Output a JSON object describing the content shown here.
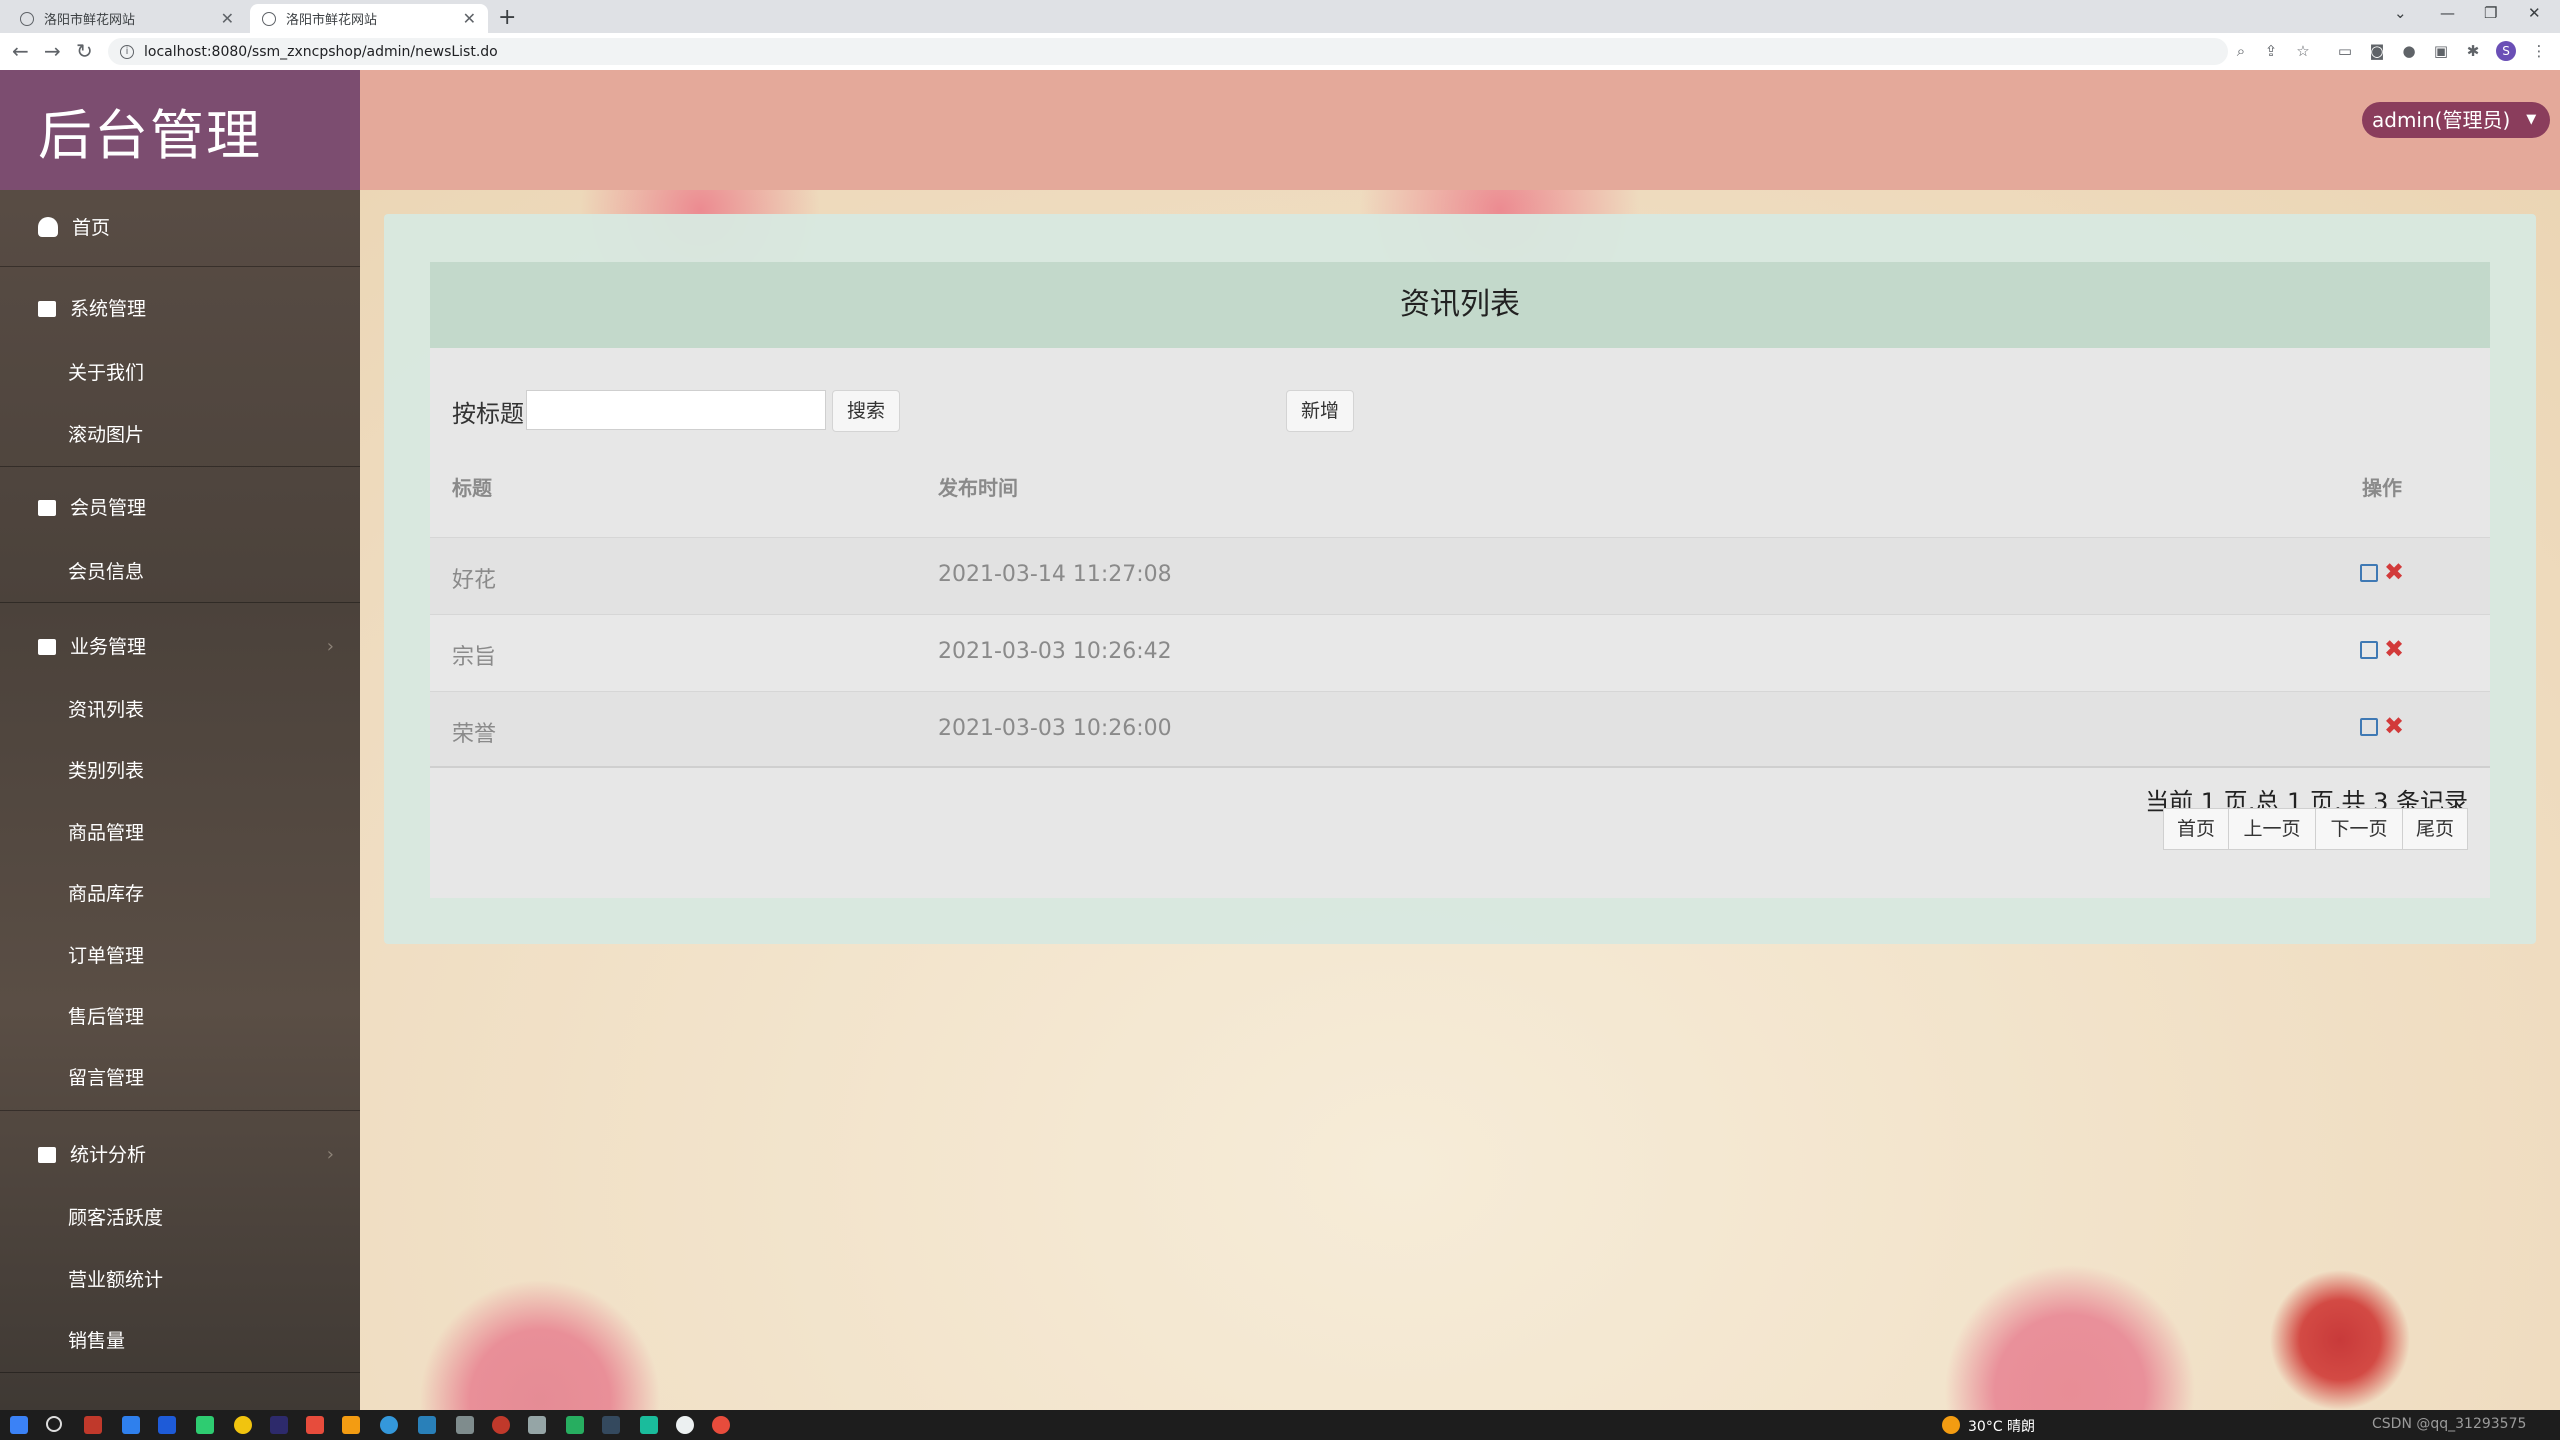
{
  "browser": {
    "tabs": [
      {
        "title": "洛阳市鲜花网站",
        "active": false
      },
      {
        "title": "洛阳市鲜花网站",
        "active": true
      }
    ],
    "url": "localhost:8080/ssm_zxncpshop/admin/newsList.do"
  },
  "sidebar": {
    "brand": "后台管理",
    "home": "首页",
    "groups": [
      {
        "label": "系统管理",
        "items": [
          "关于我们",
          "滚动图片"
        ]
      },
      {
        "label": "会员管理",
        "items": [
          "会员信息"
        ]
      },
      {
        "label": "业务管理",
        "items": [
          "资讯列表",
          "类别列表",
          "商品管理",
          "商品库存",
          "订单管理",
          "售后管理",
          "留言管理"
        ]
      },
      {
        "label": "统计分析",
        "items": [
          "顾客活跃度",
          "营业额统计",
          "销售量"
        ]
      }
    ]
  },
  "header": {
    "user": "admin(管理员)"
  },
  "main": {
    "title": "资讯列表",
    "search_label": "按标题",
    "search_value": "",
    "search_button": "搜索",
    "add_button": "新增",
    "columns": [
      "标题",
      "发布时间",
      "操作"
    ],
    "rows": [
      {
        "title": "好花",
        "time": "2021-03-14 11:27:08"
      },
      {
        "title": "宗旨",
        "time": "2021-03-03 10:26:42"
      },
      {
        "title": "荣誉",
        "time": "2021-03-03 10:26:00"
      }
    ],
    "pagination": {
      "summary": "当前 1 页,总 1 页,共 3 条记录",
      "buttons": [
        "首页",
        "上一页",
        "下一页",
        "尾页"
      ]
    }
  },
  "taskbar": {
    "weather": "30°C 晴朗",
    "watermark": "CSDN @qq_31293575"
  },
  "colors": {
    "brand": "#7c4d70",
    "topbar": "#e4a99a",
    "panel_head": "#c3d9cb",
    "user_button": "#8a3d5c",
    "delete": "#d23a3a",
    "edit": "#3f79b4"
  }
}
